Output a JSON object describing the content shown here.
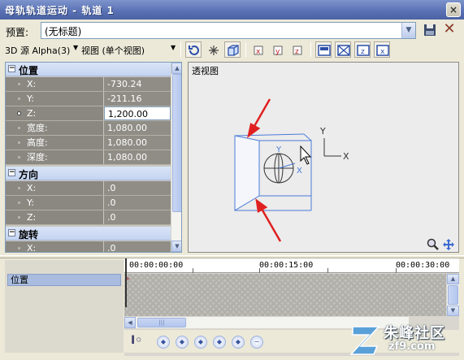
{
  "window": {
    "title": "母轨轨道运动 - 轨道 1",
    "close_glyph": "×"
  },
  "preset": {
    "label": "预置:",
    "value": "(无标题)"
  },
  "toolbar": {
    "source_label": "3D 源 Alpha(3)",
    "view_label": "视图 (单个视图)",
    "buttons": [
      "rotate-icon",
      "scale-icon",
      "cube-icon",
      "x-lock-icon",
      "y-lock-icon",
      "z-lock-icon",
      "view-single-icon",
      "view-cross-icon",
      "view-z-icon",
      "view-x-icon"
    ]
  },
  "properties": {
    "groups": [
      {
        "label": "位置",
        "toggle": "−",
        "rows": [
          {
            "name": "X:",
            "value": "-730.24"
          },
          {
            "name": "Y:",
            "value": "-211.16"
          },
          {
            "name": "Z:",
            "value": "1,200.00",
            "selected": true
          },
          {
            "name": "宽度:",
            "value": "1,080.00"
          },
          {
            "name": "高度:",
            "value": "1,080.00"
          },
          {
            "name": "深度:",
            "value": "1,080.00"
          }
        ]
      },
      {
        "label": "方向",
        "toggle": "−",
        "rows": [
          {
            "name": "X:",
            "value": ".0"
          },
          {
            "name": "Y:",
            "value": ".0"
          },
          {
            "name": "Z:",
            "value": ".0"
          }
        ]
      },
      {
        "label": "旋转",
        "toggle": "−",
        "rows": [
          {
            "name": "X:",
            "value": ".0"
          }
        ]
      }
    ]
  },
  "viewport": {
    "label": "透视图",
    "axis_x": "X",
    "axis_y": "Y",
    "gizmo_y": "Y",
    "gizmo_x": "X",
    "arrow_color": "#e02020",
    "box_color": "#4a7ad8"
  },
  "timeline": {
    "track_name": "位置",
    "times": [
      "00:00:00:00",
      "00:00:15:00",
      "00:00:30:00"
    ]
  },
  "watermark": {
    "text": "朱峰社区",
    "url": "zf9.com"
  }
}
